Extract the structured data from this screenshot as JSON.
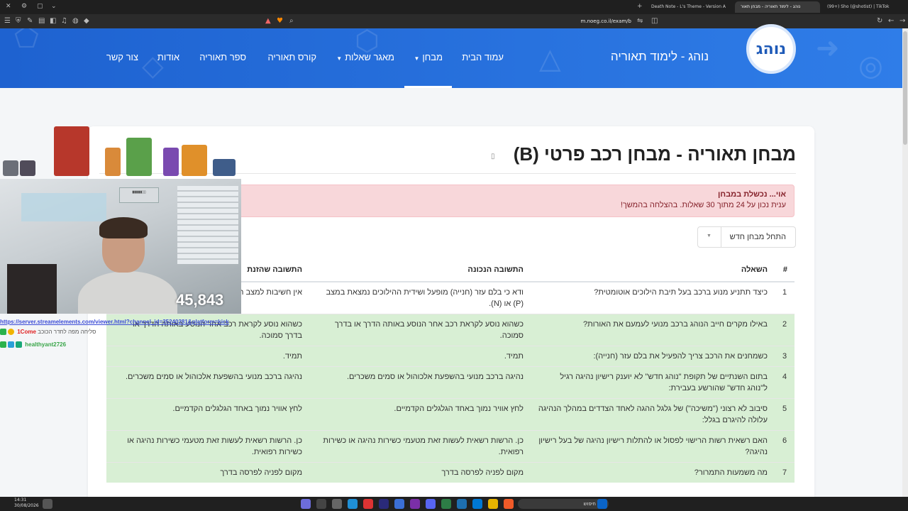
{
  "browser": {
    "tabs": [
      {
        "label": "Death Note - L's Theme - Version A"
      },
      {
        "label": "נוהג - לימוד תאוריה - מבחן תאור"
      },
      {
        "label": "(99+) Sho (@shotist) | TikTok"
      }
    ],
    "url": "m.noeg.co.il/exam/b"
  },
  "site": {
    "brand": "נוהג - לימוד תאוריה",
    "logo_text": "נוהג",
    "nav": [
      {
        "label": "עמוד הבית"
      },
      {
        "label": "מבחן"
      },
      {
        "label": "מאגר שאלות"
      },
      {
        "label": "קורס תאוריה"
      },
      {
        "label": "ספר תאוריה"
      },
      {
        "label": "אודות"
      },
      {
        "label": "צור קשר"
      }
    ]
  },
  "exam": {
    "title": "מבחן תאוריה - מבחן רכב פרטי (B)",
    "alert": {
      "heading": "אוי... נכשלת במבחן",
      "message": "ענית נכון על 24 מתוך 30 שאלות. בהצלחה בהמשך!"
    },
    "new_exam_label": "התחל מבחן חדש",
    "columns": {
      "num": "#",
      "question": "השאלה",
      "correct": "התשובה הנכונה",
      "given": "התשובה שהזנת"
    },
    "rows": [
      {
        "num": "1",
        "question": "כיצד תתניע מנוע ברכב בעל תיבת הילוכים אוטומטית?",
        "correct": "ודא כי בלם עזר (חנייה) מופעל ושידית ההילוכים נמצאת במצב (P) או (N).",
        "given": "אין חשיבות למצב ההילוך, בתנאי שבלם העזר משוחרר.",
        "status": "wrong"
      },
      {
        "num": "2",
        "question": "באילו מקרים חייב הנוהג ברכב מנועי לעמעם את האורות?",
        "correct": "כשהוא נוסע לקראת רכב אחר הנוסע באותה הדרך או בדרך סמוכה.",
        "given": "כשהוא נוסע לקראת רכב אחר הנוסע באותה הדרך או בדרך סמוכה.",
        "status": "right"
      },
      {
        "num": "3",
        "question": "כשמחנים את הרכב צריך להפעיל את בלם עזר (חנייה):",
        "correct": "תמיד.",
        "given": "תמיד.",
        "status": "right"
      },
      {
        "num": "4",
        "question": "בתום השנתיים של תקופת \"נוהג חדש\" לא יוענק רישיון נהיגה רגיל ל\"נוהג חדש\" שהורשע בעבירת:",
        "correct": "נהיגה ברכב מנועי בהשפעת אלכוהול או סמים משכרים.",
        "given": "נהיגה ברכב מנועי בהשפעת אלכוהול או סמים משכרים.",
        "status": "right"
      },
      {
        "num": "5",
        "question": "סיבוב לא רצוני (\"משיכה\") של גלגל ההגה לאחד הצדדים במהלך הנהיגה עלולה להיגרם בגלל:",
        "correct": "לחץ אוויר נמוך באחד הגלגלים הקדמיים.",
        "given": "לחץ אוויר נמוך באחד הגלגלים הקדמיים.",
        "status": "right"
      },
      {
        "num": "6",
        "question": "האם רשאית רשות הרישוי לפסול או להתלות רישיון נהיגה של בעל רישיון נהיגה?",
        "correct": "כן. הרשות רשאית לעשות זאת מטעמי כשירות נהיגה או כשירות רפואית.",
        "given": "כן. הרשות רשאית לעשות זאת מטעמי כשירות נהיגה או כשירות רפואית.",
        "status": "right"
      },
      {
        "num": "7",
        "question": "מה משמעות התמרור?",
        "correct": "מקום לפניה לפרסה בדרך",
        "given": "מקום לפניה לפרסה בדרך",
        "status": "right"
      }
    ]
  },
  "stream": {
    "viewer_count": "45,843",
    "chat": {
      "link": "https://server.streamelements.com/viewer.html?channel_id=35240281&platform=kick",
      "lines": [
        {
          "user": "1Come",
          "text": "סליחה מפה לחדר הכוכב"
        },
        {
          "user": "healthyant2726",
          "text": ""
        }
      ]
    }
  },
  "taskbar": {
    "time": "14:31",
    "date": "30/08/2026",
    "search_placeholder": "חיפוש"
  }
}
